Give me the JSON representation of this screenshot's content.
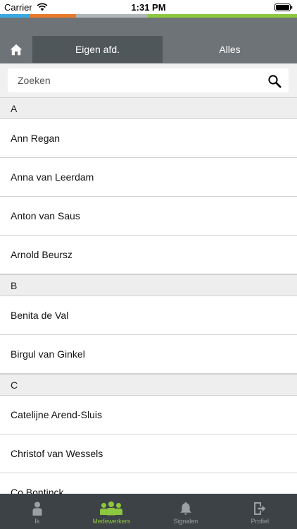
{
  "status_bar": {
    "carrier": "Carrier",
    "time": "1:31 PM"
  },
  "color_strip": [
    "#39a8e0",
    "#e8792a",
    "#b0b5b8",
    "#8dc63f"
  ],
  "header": {
    "home_icon": "home-icon",
    "tabs": [
      {
        "label": "Eigen afd.",
        "active": true
      },
      {
        "label": "Alles",
        "active": false
      }
    ]
  },
  "search": {
    "placeholder": "Zoeken",
    "value": "",
    "icon": "search-icon"
  },
  "list": [
    {
      "letter": "A",
      "names": [
        "Ann Regan",
        "Anna van Leerdam",
        "Anton van Saus",
        "Arnold Beursz"
      ]
    },
    {
      "letter": "B",
      "names": [
        "Benita de Val",
        "Birgul van Ginkel"
      ]
    },
    {
      "letter": "C",
      "names": [
        "Catelijne Arend-Sluis",
        "Christof van Wessels",
        "Co Bontinck"
      ]
    }
  ],
  "tab_bar": {
    "items": [
      {
        "label": "Ik",
        "icon": "person-icon",
        "active": false
      },
      {
        "label": "Medewerkers",
        "icon": "group-icon",
        "active": true
      },
      {
        "label": "Signalen",
        "icon": "bell-icon",
        "active": false
      },
      {
        "label": "Profiel",
        "icon": "logout-icon",
        "active": false
      }
    ]
  },
  "colors": {
    "header": "#6d7377",
    "active_segment": "#50575b",
    "tab_bar": "#3d4246",
    "accent": "#8dc63f",
    "inactive_tab": "#9aa0a4"
  }
}
